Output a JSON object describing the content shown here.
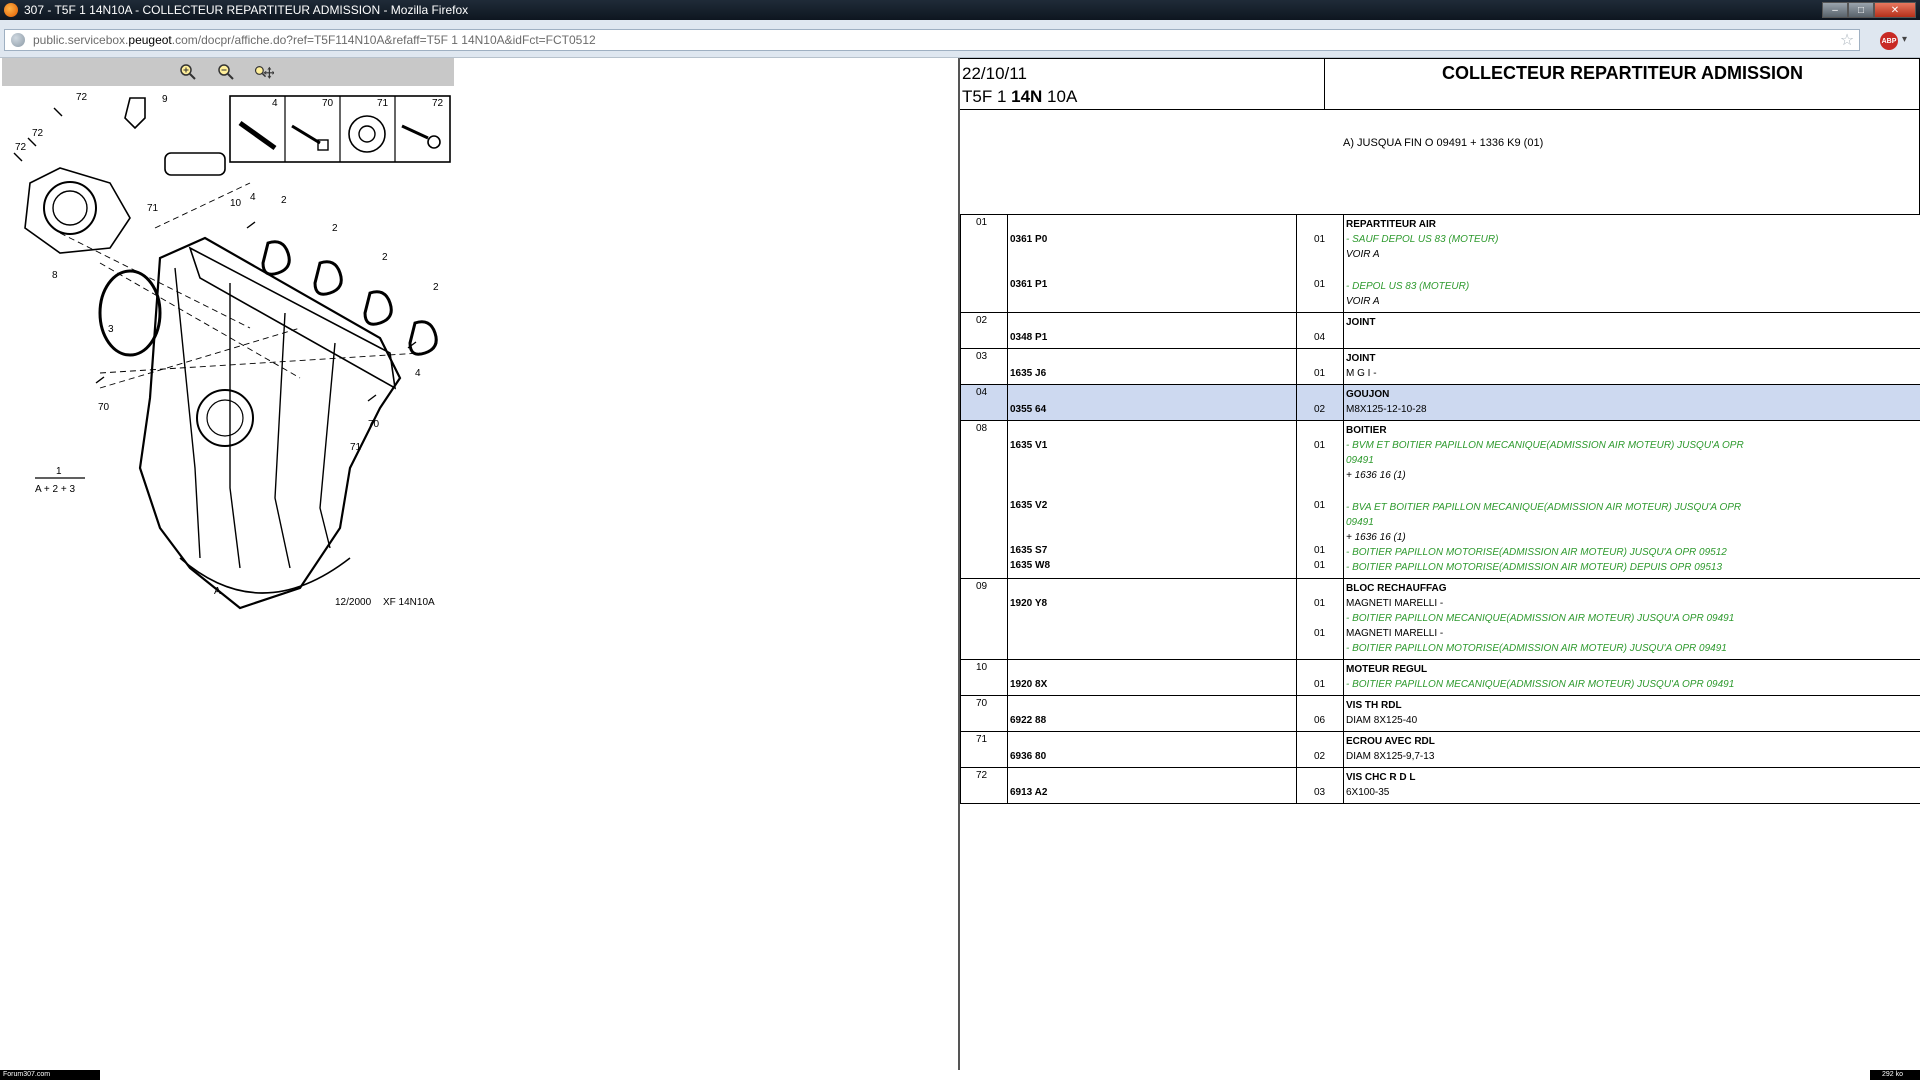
{
  "window": {
    "title": "307 - T5F 1 14N10A - COLLECTEUR REPARTITEUR ADMISSION - Mozilla Firefox",
    "buttons": {
      "minimize": "–",
      "maximize": "□",
      "close": "✕"
    }
  },
  "urlbar": {
    "url_prefix": "public.servicebox.",
    "url_domain": "peugeot",
    "url_suffix": ".com/docpr/affiche.do?ref=T5F114N10A&refaff=T5F 1 14N10A&idFct=FCT0512",
    "star": "☆",
    "addon_badge": "ABP",
    "addon_arrow": "▾"
  },
  "toolbar": {
    "zoom_in_icon": "zoom-in-icon",
    "zoom_out_icon": "zoom-out-icon",
    "pan_icon": "pan-icon"
  },
  "diagram": {
    "callouts": [
      "72",
      "9",
      "72",
      "72",
      "8",
      "10",
      "71",
      "4",
      "2",
      "2",
      "2",
      "2",
      "3",
      "70",
      "4",
      "70",
      "71",
      "A"
    ],
    "legend_parts": [
      "4",
      "70",
      "71",
      "72"
    ],
    "formula_top": "1",
    "formula_bottom": "A + 2 + 3",
    "footer_date": "12/2000",
    "footer_code": "XF 14N10A"
  },
  "header": {
    "date": "22/10/11",
    "code_prefix": "T5F 1 ",
    "code_bold": "14N",
    "code_suffix": " 10A",
    "title": "COLLECTEUR REPARTITEUR ADMISSION",
    "condition": "A) JUSQUA FIN O 09491 + 1336 K9 (01)"
  },
  "parts": [
    {
      "num": "01",
      "highlight": false,
      "rows": [
        {
          "ref": "",
          "qty": "",
          "text": "REPARTITEUR AIR",
          "style": "bold"
        },
        {
          "ref": "0361 P0",
          "qty": "01",
          "text": "- SAUF DEPOL US 83 (MOTEUR)",
          "style": "green"
        },
        {
          "ref": "",
          "qty": "",
          "text": "VOIR A",
          "style": "note"
        },
        {
          "ref": "",
          "qty": "",
          "text": "",
          "style": ""
        },
        {
          "ref": "0361 P1",
          "qty": "01",
          "text": "- DEPOL US 83 (MOTEUR)",
          "style": "green"
        },
        {
          "ref": "",
          "qty": "",
          "text": "VOIR A",
          "style": "note"
        }
      ]
    },
    {
      "num": "02",
      "highlight": false,
      "rows": [
        {
          "ref": "",
          "qty": "",
          "text": "JOINT",
          "style": "bold"
        },
        {
          "ref": "0348 P1",
          "qty": "04",
          "text": "",
          "style": ""
        }
      ]
    },
    {
      "num": "03",
      "highlight": false,
      "rows": [
        {
          "ref": "",
          "qty": "",
          "text": "JOINT",
          "style": "bold"
        },
        {
          "ref": "1635 J6",
          "qty": "01",
          "text": "M G I -",
          "style": "plain"
        }
      ]
    },
    {
      "num": "04",
      "highlight": true,
      "rows": [
        {
          "ref": "",
          "qty": "",
          "text": "GOUJON",
          "style": "bold"
        },
        {
          "ref": "0355 64",
          "qty": "02",
          "text": "M8X125-12-10-28",
          "style": "plain"
        }
      ]
    },
    {
      "num": "08",
      "highlight": false,
      "rows": [
        {
          "ref": "",
          "qty": "",
          "text": "BOITIER",
          "style": "bold"
        },
        {
          "ref": "1635 V1",
          "qty": "01",
          "text": "- BVM ET BOITIER PAPILLON MECANIQUE(ADMISSION AIR MOTEUR) JUSQU'A OPR",
          "style": "green"
        },
        {
          "ref": "",
          "qty": "",
          "text": "09491",
          "style": "green"
        },
        {
          "ref": "",
          "qty": "",
          "text": "+ 1636 16 (1)",
          "style": "note"
        },
        {
          "ref": "",
          "qty": "",
          "text": "",
          "style": ""
        },
        {
          "ref": "1635 V2",
          "qty": "01",
          "text": "- BVA ET BOITIER PAPILLON MECANIQUE(ADMISSION AIR MOTEUR) JUSQU'A OPR",
          "style": "green"
        },
        {
          "ref": "",
          "qty": "",
          "text": "09491",
          "style": "green"
        },
        {
          "ref": "",
          "qty": "",
          "text": "+ 1636 16 (1)",
          "style": "note"
        },
        {
          "ref": "1635 S7",
          "qty": "01",
          "text": "- BOITIER PAPILLON MOTORISE(ADMISSION AIR MOTEUR) JUSQU'A OPR 09512",
          "style": "green"
        },
        {
          "ref": "1635 W8",
          "qty": "01",
          "text": "- BOITIER PAPILLON MOTORISE(ADMISSION AIR MOTEUR) DEPUIS OPR 09513",
          "style": "green"
        }
      ]
    },
    {
      "num": "09",
      "highlight": false,
      "rows": [
        {
          "ref": "",
          "qty": "",
          "text": "BLOC RECHAUFFAG",
          "style": "bold"
        },
        {
          "ref": "1920 Y8",
          "qty": "01",
          "text": "MAGNETI MARELLI -",
          "style": "plain"
        },
        {
          "ref": "",
          "qty": "",
          "text": "- BOITIER PAPILLON MECANIQUE(ADMISSION AIR MOTEUR) JUSQU'A OPR 09491",
          "style": "green"
        },
        {
          "ref": "",
          "qty": "01",
          "text": "MAGNETI MARELLI -",
          "style": "plain"
        },
        {
          "ref": "",
          "qty": "",
          "text": "- BOITIER PAPILLON MOTORISE(ADMISSION AIR MOTEUR) JUSQU'A OPR 09491",
          "style": "green"
        }
      ]
    },
    {
      "num": "10",
      "highlight": false,
      "rows": [
        {
          "ref": "",
          "qty": "",
          "text": "MOTEUR REGUL",
          "style": "bold"
        },
        {
          "ref": "1920 8X",
          "qty": "01",
          "text": "- BOITIER PAPILLON MECANIQUE(ADMISSION AIR MOTEUR) JUSQU'A OPR 09491",
          "style": "green"
        }
      ]
    },
    {
      "num": "70",
      "highlight": false,
      "rows": [
        {
          "ref": "",
          "qty": "",
          "text": "VIS TH RDL",
          "style": "bold"
        },
        {
          "ref": "6922 88",
          "qty": "06",
          "text": "DIAM 8X125-40",
          "style": "plain"
        }
      ]
    },
    {
      "num": "71",
      "highlight": false,
      "rows": [
        {
          "ref": "",
          "qty": "",
          "text": "ECROU AVEC RDL",
          "style": "bold"
        },
        {
          "ref": "6936 80",
          "qty": "02",
          "text": "DIAM 8X125-9,7-13",
          "style": "plain"
        }
      ]
    },
    {
      "num": "72",
      "highlight": false,
      "rows": [
        {
          "ref": "",
          "qty": "",
          "text": "VIS CHC R D L",
          "style": "bold"
        },
        {
          "ref": "6913 A2",
          "qty": "03",
          "text": "6X100-35",
          "style": "plain"
        }
      ]
    }
  ],
  "statusbar": {
    "left": "Forum307.com",
    "right": "292 ko"
  },
  "colors": {
    "highlight": "#cdd9f0",
    "green_text": "#2e9a2e",
    "titlebar": "#0e1620"
  }
}
